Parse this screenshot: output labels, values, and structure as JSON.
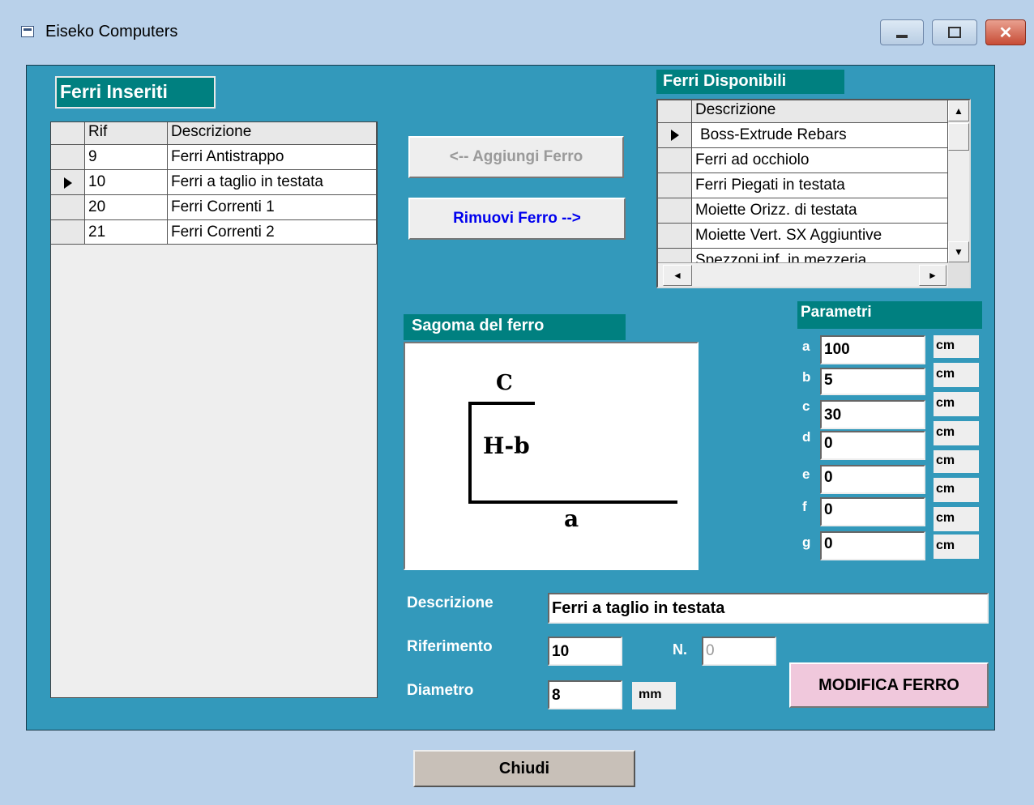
{
  "window": {
    "title": "Eiseko Computers"
  },
  "left_panel": {
    "title": "Ferri Inseriti",
    "columns": [
      "Rif",
      "Descrizione"
    ],
    "rows": [
      {
        "rif": "9",
        "descrizione": "Ferri Antistrappo",
        "selected": false
      },
      {
        "rif": "10",
        "descrizione": "Ferri a taglio in testata",
        "selected": true
      },
      {
        "rif": "20",
        "descrizione": "Ferri Correnti  1",
        "selected": false
      },
      {
        "rif": "21",
        "descrizione": "Ferri Correnti  2",
        "selected": false
      }
    ]
  },
  "buttons": {
    "add": "<-- Aggiungi Ferro",
    "remove": "Rimuovi Ferro   -->",
    "modify": "MODIFICA FERRO",
    "close": "Chiudi"
  },
  "available": {
    "title": "Ferri Disponibili",
    "column": "Descrizione",
    "items": [
      "Boss-Extrude Rebars",
      "Ferri ad occhiolo",
      "Ferri Piegati in testata",
      "Moiette Orizz. di testata",
      "Moiette Vert. SX Aggiuntive",
      "Spezzoni inf. in mezzeria"
    ]
  },
  "shape": {
    "title": "Sagoma del ferro",
    "labels": {
      "c": "C",
      "hb": "H-b",
      "a": "a"
    }
  },
  "params": {
    "title": "Parametri",
    "items": [
      {
        "label": "a",
        "value": "100",
        "unit": "cm"
      },
      {
        "label": "b",
        "value": "5",
        "unit": "cm"
      },
      {
        "label": "c",
        "value": "30",
        "unit": "cm"
      },
      {
        "label": "d",
        "value": "0",
        "unit": "cm"
      },
      {
        "label": "e",
        "value": "0",
        "unit": "cm"
      },
      {
        "label": "f",
        "value": "0",
        "unit": "cm"
      },
      {
        "label": "g",
        "value": "0",
        "unit": "cm"
      }
    ],
    "extra_unit": "cm"
  },
  "form": {
    "descrizione_label": "Descrizione",
    "descrizione_value": "Ferri a taglio in testata",
    "riferimento_label": "Riferimento",
    "riferimento_value": "10",
    "n_label": "N.",
    "n_value": "0",
    "diametro_label": "Diametro",
    "diametro_value": "8",
    "diametro_unit": "mm"
  },
  "colors": {
    "panel": "#3399bb",
    "teal_label": "#008080",
    "modify_button": "#f0c8dc",
    "close_button": "#c8c0b8"
  }
}
